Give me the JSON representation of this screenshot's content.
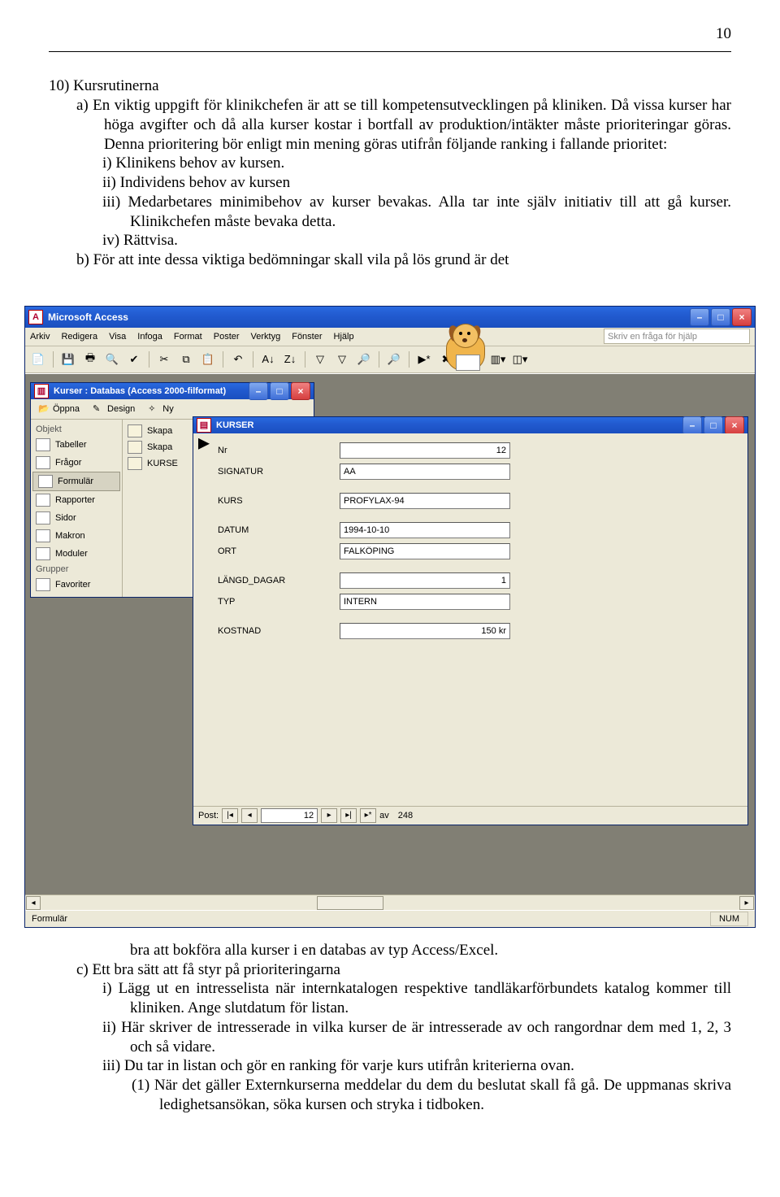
{
  "page_number": "10",
  "text": {
    "l1": "10) Kursrutinerna",
    "l2": "a)  En viktig uppgift för klinikchefen är att se till kompetensutvecklingen på kliniken. Då vissa kurser har höga avgifter och då alla kurser kostar i bortfall av produktion/intäkter måste prioriteringar göras. Denna prioritering bör enligt min mening göras utifrån följande ranking i fallande prioritet:",
    "l3": "i)   Klinikens behov av kursen.",
    "l4": "ii)  Individens behov av kursen",
    "l5": "iii) Medarbetares minimibehov av kurser bevakas. Alla tar inte själv initiativ till att gå kurser. Klinikchefen måste bevaka detta.",
    "l6": "iv) Rättvisa.",
    "l7": "b)  För att inte dessa viktiga bedömningar skall vila på lös grund är det",
    "after1": "bra att bokföra alla kurser i en databas av typ Access/Excel.",
    "after2": "c)  Ett bra sätt att få styr på prioriteringarna",
    "after3": "i)   Lägg ut en intresselista när internkatalogen respektive tandläkarförbundets katalog kommer till kliniken. Ange slutdatum för listan.",
    "after4": "ii)  Här skriver de intresserade in vilka kurser de är intresserade av och rangordnar dem med 1, 2, 3 och så vidare.",
    "after5": "iii) Du tar in listan och gör en ranking för varje kurs utifrån kriterierna ovan.",
    "after6": "(1) När det gäller Externkurserna meddelar du dem du beslutat skall få gå. De uppmanas skriva ledighetsansökan, söka kursen och stryka i tidboken."
  },
  "app": {
    "title": "Microsoft Access",
    "menus": [
      "Arkiv",
      "Redigera",
      "Visa",
      "Infoga",
      "Format",
      "Poster",
      "Verktyg",
      "Fönster",
      "Hjälp"
    ],
    "help_placeholder": "Skriv en fråga för hjälp",
    "status_left": "Formulär",
    "status_right": "NUM"
  },
  "db_window": {
    "title": "Kurser : Databas (Access 2000-filformat)",
    "toolbar": [
      "Öppna",
      "Design",
      "Ny"
    ],
    "groups_label": "Grupper",
    "objects_label": "Objekt",
    "objects": [
      "Tabeller",
      "Frågor",
      "Formulär",
      "Rapporter",
      "Sidor",
      "Makron",
      "Moduler"
    ],
    "favorites": "Favoriter",
    "list": [
      "Skapa",
      "Skapa",
      "KURSE"
    ]
  },
  "form": {
    "title": "KURSER",
    "fields": [
      {
        "label": "Nr",
        "value": "12",
        "align": "right"
      },
      {
        "label": "SIGNATUR",
        "value": "AA",
        "align": "left"
      },
      {
        "label": "KURS",
        "value": "PROFYLAX-94",
        "align": "left"
      },
      {
        "label": "DATUM",
        "value": "1994-10-10",
        "align": "left"
      },
      {
        "label": "ORT",
        "value": "FALKÖPING",
        "align": "left"
      },
      {
        "label": "LÄNGD_DAGAR",
        "value": "1",
        "align": "right"
      },
      {
        "label": "TYP",
        "value": "INTERN",
        "align": "left"
      },
      {
        "label": "KOSTNAD",
        "value": "150 kr",
        "align": "right"
      }
    ],
    "nav": {
      "label": "Post:",
      "current": "12",
      "of_label": "av",
      "total": "248"
    }
  }
}
